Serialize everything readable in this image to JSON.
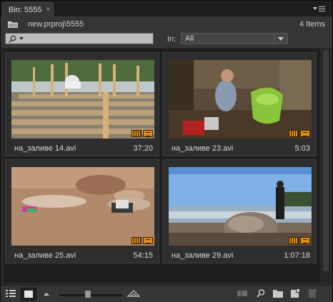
{
  "tab": {
    "label": "Bin: 5555",
    "close": "×"
  },
  "path": {
    "text": "new.prproj\\5555",
    "items_count": "4 Items"
  },
  "search": {
    "placeholder": "",
    "in_label": "In:",
    "in_value": "All"
  },
  "clips": [
    {
      "name": "на_заливе 14.avi",
      "duration": "37:20"
    },
    {
      "name": "на_заливе 23.avi",
      "duration": "5:03"
    },
    {
      "name": "на_заливе 25.avi",
      "duration": "54:15"
    },
    {
      "name": "на_заливе 29.avi",
      "duration": "1:07:18"
    }
  ],
  "bottom": {
    "zoom_level": 0.45
  },
  "colors": {
    "panel": "#2a2a2a",
    "badge": "#e08a12",
    "search_bg": "#bcbcbc"
  }
}
